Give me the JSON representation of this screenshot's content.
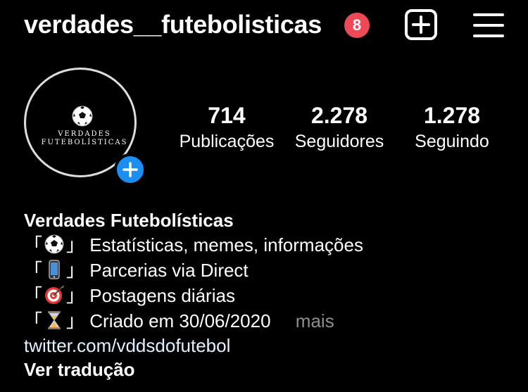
{
  "header": {
    "username": "verdades__futebolisticas",
    "notification_count": "8",
    "badge_color": "#ed4956"
  },
  "avatar": {
    "line1": "VERDADES",
    "line2": "FUTEBOLÍSTICAS",
    "icon": "soccer-ball-icon"
  },
  "stats": {
    "posts": {
      "value": "714",
      "label": "Publicações"
    },
    "followers": {
      "value": "2.278",
      "label": "Seguidores"
    },
    "following": {
      "value": "1.278",
      "label": "Seguindo"
    }
  },
  "bio": {
    "name": "Verdades Futebolísticas",
    "bracket_open": "「",
    "bracket_close": "」",
    "lines": [
      {
        "icon": "soccer-ball-icon",
        "text": "Estatísticas, memes, informações"
      },
      {
        "icon": "mobile-phone-icon",
        "text": "Parcerias via Direct"
      },
      {
        "icon": "dart-target-icon",
        "text": "Postagens diárias"
      },
      {
        "icon": "hourglass-icon",
        "text": "Criado em 30/06/2020"
      }
    ],
    "more": "mais",
    "link": "twitter.com/vddsdofutebol",
    "translate": "Ver tradução"
  },
  "colors": {
    "background": "#000000",
    "accent_blue": "#1b8ef2",
    "muted": "#8e8e8e"
  }
}
